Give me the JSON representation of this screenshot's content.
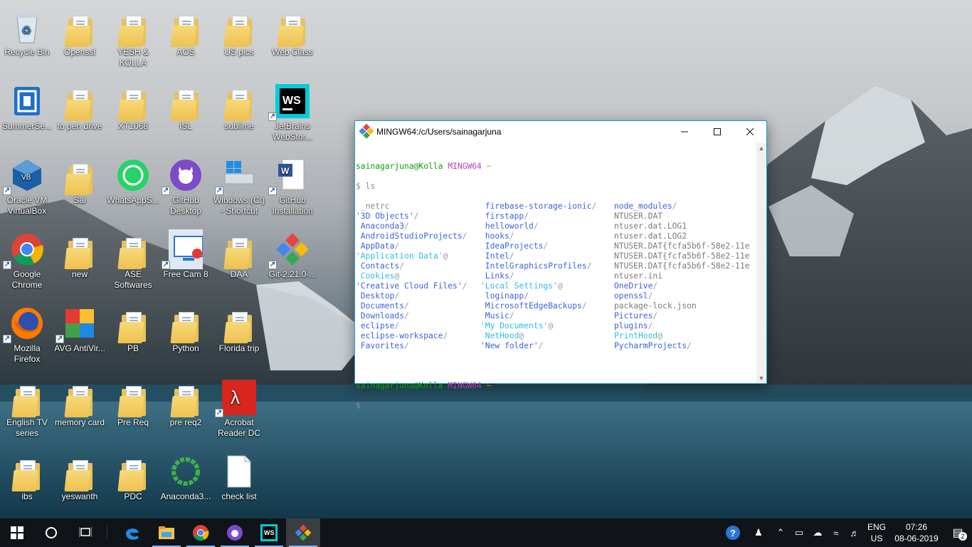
{
  "desktop": {
    "icons": [
      {
        "label": "Recycle Bin",
        "kind": "recycle"
      },
      {
        "label": "Openssl",
        "kind": "folder"
      },
      {
        "label": "YESH & KOLLA",
        "kind": "folder"
      },
      {
        "label": "AOS",
        "kind": "folder"
      },
      {
        "label": "US pics",
        "kind": "folder"
      },
      {
        "label": "Web Class",
        "kind": "folder"
      },
      {
        "label": "SummerSe...",
        "kind": "app"
      },
      {
        "label": "to pen drive",
        "kind": "folder"
      },
      {
        "label": "XT1068",
        "kind": "folder"
      },
      {
        "label": "ISL",
        "kind": "folder"
      },
      {
        "label": "sublime",
        "kind": "folder"
      },
      {
        "label": "JetBrains WebStor...",
        "kind": "webstorm"
      },
      {
        "label": "Oracle VM VirtualBox",
        "kind": "virtualbox"
      },
      {
        "label": "Sai",
        "kind": "folder"
      },
      {
        "label": "WhatsAppS...",
        "kind": "whatsapp"
      },
      {
        "label": "GitHub Desktop",
        "kind": "github"
      },
      {
        "label": "Windows (C:) - Shortcut",
        "kind": "drive"
      },
      {
        "label": "GitHub Installation",
        "kind": "document"
      },
      {
        "label": "Google Chrome",
        "kind": "chrome"
      },
      {
        "label": "new",
        "kind": "folder"
      },
      {
        "label": "ASE Softwares",
        "kind": "folder"
      },
      {
        "label": "Free Cam 8",
        "kind": "freecam"
      },
      {
        "label": "DAA",
        "kind": "folder"
      },
      {
        "label": "Git-2.21.0-...",
        "kind": "git"
      },
      {
        "label": "Mozilla Firefox",
        "kind": "firefox"
      },
      {
        "label": "AVG AntiVir...",
        "kind": "avg"
      },
      {
        "label": "PB",
        "kind": "folder"
      },
      {
        "label": "Python",
        "kind": "folder"
      },
      {
        "label": "Florida trip",
        "kind": "folder"
      },
      {
        "label": "English TV series",
        "kind": "folder"
      },
      {
        "label": "memory card",
        "kind": "folder"
      },
      {
        "label": "Pre Req",
        "kind": "folder"
      },
      {
        "label": "pre req2",
        "kind": "folder"
      },
      {
        "label": "Acrobat Reader DC",
        "kind": "acrobat"
      },
      {
        "label": "ibs",
        "kind": "folder"
      },
      {
        "label": "yeswanth",
        "kind": "folder"
      },
      {
        "label": "PDC",
        "kind": "folder"
      },
      {
        "label": "Anaconda3...",
        "kind": "anaconda"
      },
      {
        "label": "check list",
        "kind": "file"
      }
    ]
  },
  "terminal": {
    "title": "MINGW64:/c/Users/sainagarjuna",
    "prompt_user": "sainagarjuna@Kolla",
    "prompt_env": "MINGW64",
    "prompt_path": "~",
    "command": "$ ls",
    "cursor_line": "$",
    "columns": [
      [
        {
          "text": " _netrc",
          "type": "hidden"
        },
        {
          "text": "'3D Objects'",
          "type": "dir",
          "suffix": "/"
        },
        {
          "text": " Anaconda3",
          "type": "dir",
          "suffix": "/"
        },
        {
          "text": " AndroidStudioProjects",
          "type": "dir",
          "suffix": "/"
        },
        {
          "text": " AppData",
          "type": "dir",
          "suffix": "/"
        },
        {
          "text": "'Application Data'",
          "type": "link",
          "suffix": "@"
        },
        {
          "text": " Contacts",
          "type": "dir",
          "suffix": "/"
        },
        {
          "text": " Cookies",
          "type": "link",
          "suffix": "@"
        },
        {
          "text": "'Creative Cloud Files'",
          "type": "dir",
          "suffix": "/"
        },
        {
          "text": " Desktop",
          "type": "dir",
          "suffix": "/"
        },
        {
          "text": " Documents",
          "type": "dir",
          "suffix": "/"
        },
        {
          "text": " Downloads",
          "type": "dir",
          "suffix": "/"
        },
        {
          "text": " eclipse",
          "type": "dir",
          "suffix": "/"
        },
        {
          "text": " eclipse-workspace",
          "type": "dir",
          "suffix": "/"
        },
        {
          "text": " Favorites",
          "type": "dir",
          "suffix": "/"
        }
      ],
      [
        {
          "text": " firebase-storage-ionic",
          "type": "dir",
          "suffix": "/"
        },
        {
          "text": " firstapp",
          "type": "dir",
          "suffix": "/"
        },
        {
          "text": " helloworld",
          "type": "dir",
          "suffix": "/"
        },
        {
          "text": " hooks",
          "type": "dir",
          "suffix": "/"
        },
        {
          "text": " IdeaProjects",
          "type": "dir",
          "suffix": "/"
        },
        {
          "text": " Intel",
          "type": "dir",
          "suffix": "/"
        },
        {
          "text": " IntelGraphicsProfiles",
          "type": "dir",
          "suffix": "/"
        },
        {
          "text": " Links",
          "type": "dir",
          "suffix": "/"
        },
        {
          "text": "'Local Settings'",
          "type": "link",
          "suffix": "@"
        },
        {
          "text": " loginapp",
          "type": "dir",
          "suffix": "/"
        },
        {
          "text": " MicrosoftEdgeBackups",
          "type": "dir",
          "suffix": "/"
        },
        {
          "text": " Music",
          "type": "dir",
          "suffix": "/"
        },
        {
          "text": "'My Documents'",
          "type": "link",
          "suffix": "@"
        },
        {
          "text": " NetHood",
          "type": "link",
          "suffix": "@"
        },
        {
          "text": "'New folder'",
          "type": "dir",
          "suffix": "/"
        }
      ],
      [
        {
          "text": "node_modules",
          "type": "dir",
          "suffix": "/"
        },
        {
          "text": "NTUSER.DAT",
          "type": "file",
          "suffix": ""
        },
        {
          "text": "ntuser.dat.LOG1",
          "type": "file",
          "suffix": ""
        },
        {
          "text": "ntuser.dat.LOG2",
          "type": "file",
          "suffix": ""
        },
        {
          "text": "NTUSER.DAT{fcfa5b6f-58e2-11e",
          "type": "file",
          "suffix": ""
        },
        {
          "text": "NTUSER.DAT{fcfa5b6f-58e2-11e",
          "type": "file",
          "suffix": ""
        },
        {
          "text": "NTUSER.DAT{fcfa5b6f-58e2-11e",
          "type": "file",
          "suffix": ""
        },
        {
          "text": "ntuser.ini",
          "type": "file",
          "suffix": ""
        },
        {
          "text": "OneDrive",
          "type": "dir",
          "suffix": "/"
        },
        {
          "text": "openssl",
          "type": "dir",
          "suffix": "/"
        },
        {
          "text": "package-lock.json",
          "type": "file",
          "suffix": ""
        },
        {
          "text": "Pictures",
          "type": "dir",
          "suffix": "/"
        },
        {
          "text": "plugins",
          "type": "dir",
          "suffix": "/"
        },
        {
          "text": "PrintHood",
          "type": "link",
          "suffix": "@"
        },
        {
          "text": "PycharmProjects",
          "type": "dir",
          "suffix": "/"
        }
      ]
    ]
  },
  "taskbar": {
    "apps": [
      "start-icon",
      "search-icon",
      "task-view-icon",
      "edge-icon",
      "file-explorer-icon",
      "chrome-icon",
      "github-desktop-icon",
      "webstorm-icon",
      "git-bash-icon"
    ],
    "lang_top": "ENG",
    "lang_bottom": "US",
    "time": "07:26",
    "date": "08-06-2019",
    "notification_count": "2"
  },
  "colors": {
    "accent": "#1ea0c8",
    "prompt_green": "#0da10d",
    "prompt_magenta": "#bc3fbc",
    "prompt_yellow": "#c19c00",
    "dir_blue": "#3b63e0",
    "link_cyan": "#2bc0e0"
  }
}
